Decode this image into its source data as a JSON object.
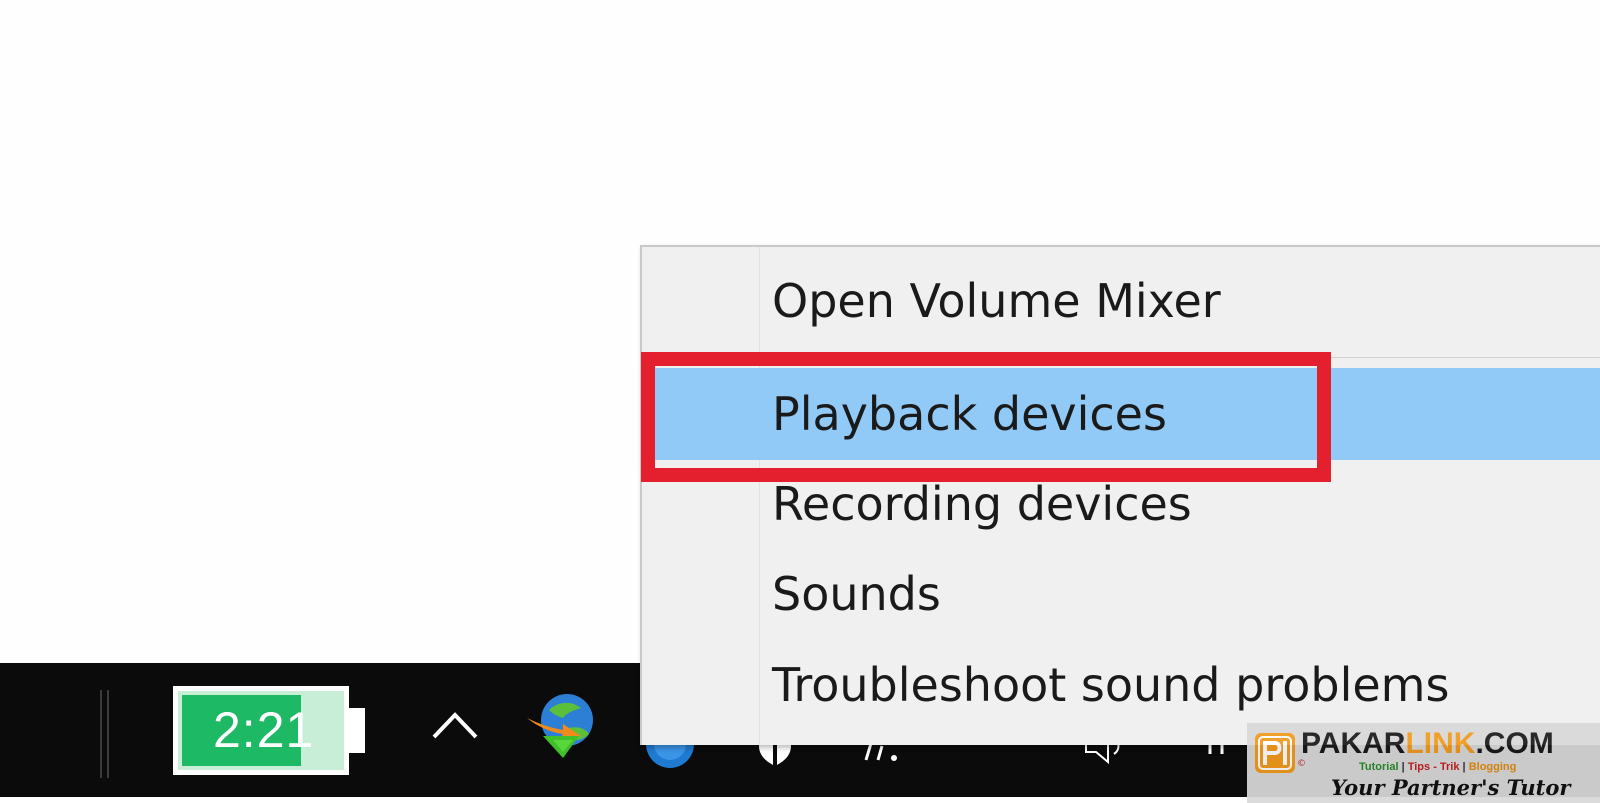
{
  "taskbar": {
    "battery": {
      "time_label": "2:21",
      "charge_level": 0.75,
      "fill_color": "#1db964"
    },
    "tray_icons": [
      "chevron-up-icon",
      "idm-icon",
      "network-icon",
      "speaker-icon"
    ]
  },
  "context_menu": {
    "items": [
      {
        "label": "Open Volume Mixer"
      },
      {
        "label": "Playback devices",
        "selected": true
      },
      {
        "label": "Recording devices"
      },
      {
        "label": "Sounds"
      },
      {
        "label": "Troubleshoot sound problems"
      }
    ],
    "highlight_color": "#91c9f7",
    "annotation_color": "#e5202e"
  },
  "watermark": {
    "brand_part1": "PAKAR",
    "brand_part2": "LINK",
    "brand_part3": ".COM",
    "tag1": "Tutorial",
    "tag2": "Tips - Trik",
    "tag3": "Blogging",
    "separator": "|",
    "slogan": "Your Partner's Tutor"
  }
}
